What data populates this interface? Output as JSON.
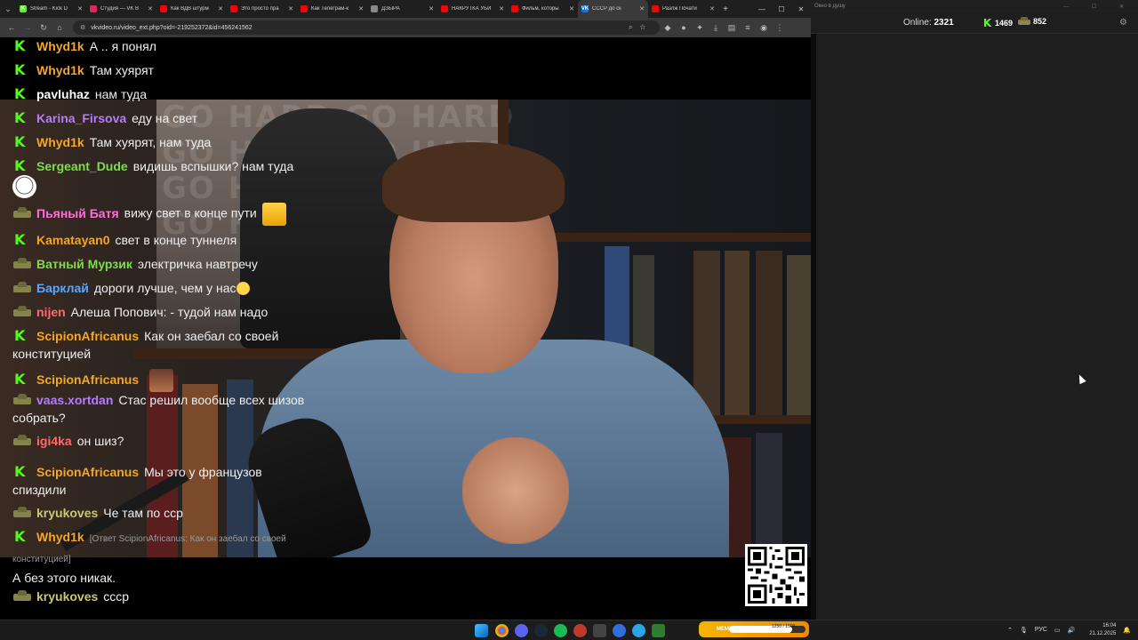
{
  "browser": {
    "tabs": [
      {
        "title": "Stream - Kick D",
        "fav_color": "#53fc18",
        "fav_glyph": "K"
      },
      {
        "title": "Студия — VK В",
        "fav_color": "#e0245e",
        "fav_glyph": ""
      },
      {
        "title": "Как ВДВ штурм",
        "fav_color": "#ff0000",
        "fav_glyph": ""
      },
      {
        "title": "Это просто пра",
        "fav_color": "#ff0000",
        "fav_glyph": ""
      },
      {
        "title": "Как Телеграм-к",
        "fav_color": "#ff0000",
        "fav_glyph": ""
      },
      {
        "title": "ДЗЫРА",
        "fav_color": "#888888",
        "fav_glyph": ""
      },
      {
        "title": "НАКРУТКА УБИ",
        "fav_color": "#ff0000",
        "fav_glyph": ""
      },
      {
        "title": "Фильм, которы",
        "fav_color": "#ff0000",
        "fav_glyph": ""
      },
      {
        "title": "СССР до ск",
        "fav_color": "#0077ff",
        "fav_glyph": "VK",
        "active": true
      },
      {
        "title": "Разлж Почати",
        "fav_color": "#ff0000",
        "fav_glyph": ""
      }
    ],
    "new_tab": "+",
    "window_controls": [
      "—",
      "☐",
      "✕"
    ],
    "url": "vkvideo.ru/video_ext.php?oid=-219252372&id=456241562"
  },
  "chat": {
    "window_title": "Окно в душу",
    "online_label": "Online:",
    "online_count": "2321",
    "k_count": "1469",
    "tank_count": "852",
    "messages": [
      {
        "badge": "k",
        "user": "Whyd1k",
        "color": "#f5a623",
        "text": "А .. я понял"
      },
      {
        "badge": "k",
        "user": "Whyd1k",
        "color": "#f5a623",
        "text": "Там хуярят"
      },
      {
        "badge": "k",
        "user": "pavluhaz",
        "color": "#ffffff",
        "text": "нам туда"
      },
      {
        "badge": "k",
        "user": "Karina_Firsova",
        "color": "#b57cff",
        "text": "еду на свет"
      },
      {
        "badge": "k",
        "user": "Whyd1k",
        "color": "#f5a623",
        "text": "Там хуярят, нам туда"
      },
      {
        "badge": "k",
        "user": "Sergeant_Dude",
        "color": "#7cdf4a",
        "text": "видишь вспышки? нам туда",
        "emote": "troll-face-emote"
      },
      {
        "badge": "tank",
        "user": "Пьяный Батя",
        "color": "#ff6fd6",
        "text": "вижу свет в конце пути",
        "emote": "yellow-face-emote"
      },
      {
        "badge": "k",
        "user": "Kamatayan0",
        "color": "#f5a623",
        "text": "свет в конце туннеля"
      },
      {
        "badge": "tank",
        "user": "Ватный Мурзик",
        "color": "#7cdf4a",
        "text": "электричка навтречу"
      },
      {
        "badge": "tank",
        "user": "Барклай",
        "color": "#5aa7ff",
        "text": "дороги лучше, чем у нас",
        "emote": "laughing-emoji"
      },
      {
        "badge": "tank",
        "user": "nijen",
        "color": "#ff6b6b",
        "text": "Алеша Попович: - тудой нам надо"
      },
      {
        "badge": "k",
        "user": "ScipionAfricanus",
        "color": "#f5a623",
        "text": "Как он заебал со своей конституцией"
      },
      {
        "badge": "k",
        "user": "ScipionAfricanus",
        "color": "#f5a623",
        "text": "",
        "emote": "man-face-emote"
      },
      {
        "badge": "tank",
        "user": "vaas.xortdan",
        "color": "#b57cff",
        "text": "Стас решил вообще всех шизов собрать?"
      },
      {
        "badge": "tank",
        "user": "igi4ka",
        "color": "#ff6b6b",
        "text": "он шиз?"
      },
      {
        "badge": "k",
        "user": "ScipionAfricanus",
        "color": "#f5a623",
        "text": "Мы это у французов спиздили"
      },
      {
        "badge": "tank",
        "user": "kryukoves",
        "color": "#c8c86e",
        "text": "Че там по сср"
      },
      {
        "badge": "k",
        "user": "Whyd1k",
        "color": "#f5a623",
        "reply": "[Ответ ScipionAfricanus: Как он заебал со своей конституцией]",
        "text": "А без этого никак."
      },
      {
        "badge": "tank",
        "user": "kryukoves",
        "color": "#c8c86e",
        "text": "сссp"
      }
    ]
  },
  "taskbar": {
    "meme_title": "MEME PARTY",
    "meme_progress_label": "1250 / 1500",
    "meme_progress": 0.83,
    "tray_lang": "РУС",
    "time": "16:04",
    "date": "21.12.2025"
  }
}
